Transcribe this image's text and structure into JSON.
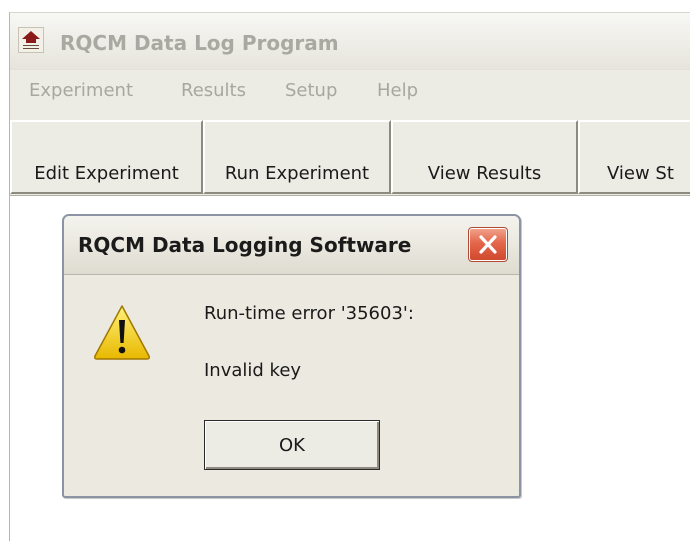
{
  "window": {
    "title": "RQCM Data Log Program",
    "icon": "rqcm-app-icon"
  },
  "menu": {
    "items": [
      {
        "label": "Experiment"
      },
      {
        "label": "Results"
      },
      {
        "label": "Setup"
      },
      {
        "label": "Help"
      }
    ]
  },
  "toolbar": {
    "buttons": [
      {
        "label": "Edit Experiment"
      },
      {
        "label": "Run Experiment"
      },
      {
        "label": "View Results"
      },
      {
        "label": "View St"
      }
    ]
  },
  "dialog": {
    "title": "RQCM Data Logging Software",
    "close_icon": "close-icon",
    "message_icon": "warning-icon",
    "message": "Run-time error '35603':",
    "detail": "Invalid key",
    "ok_label": "OK"
  },
  "colors": {
    "disabled_text": "#a8a79f",
    "chrome": "#ecebe4",
    "close_red": "#e4664a",
    "warning_yellow": "#f5d21a"
  }
}
